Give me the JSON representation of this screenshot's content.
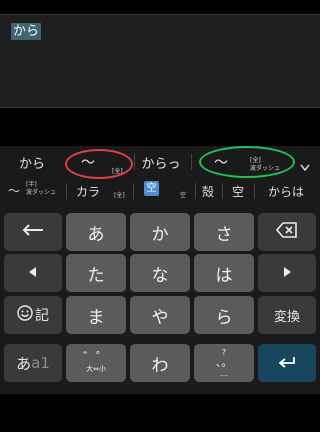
{
  "editor": {
    "text": "から"
  },
  "candidates_row1": [
    {
      "label": "から"
    },
    {
      "label": "〜",
      "tag": "[全]"
    },
    {
      "label": "からっ"
    },
    {
      "label": "〜",
      "tag_top": "[全]",
      "tag_bottom": "波ダッシュ"
    }
  ],
  "candidates_row2": [
    {
      "label": "〜",
      "tag_top": "[半]",
      "tag_bottom": "波ダッシュ"
    },
    {
      "label": "カラ",
      "tag": "[全]"
    },
    {
      "label": "空",
      "tag": "空"
    },
    {
      "label": "殻"
    },
    {
      "label": "空"
    },
    {
      "label": "からは"
    }
  ],
  "keys": {
    "row1": [
      "あ",
      "か",
      "さ"
    ],
    "row2": [
      "た",
      "な",
      "は"
    ],
    "row3": [
      "ま",
      "や",
      "ら"
    ],
    "row4_center": [
      "わ"
    ],
    "kigou": "記",
    "henkan": "変換",
    "mode_a": "あ",
    "mode_b": "a1",
    "dakuten_top": "゛゜",
    "dakuten_bottom": "大⇔小",
    "punct_top": "?",
    "punct_mid": "、。",
    "punct_bottom": "…"
  },
  "colors": {
    "selection": "#3d6470",
    "char_key": "#5b5b5b",
    "fn_key": "#3a3a3a",
    "enter_key": "#17465d",
    "red_circle": "#e04040",
    "green_circle": "#22c155"
  }
}
